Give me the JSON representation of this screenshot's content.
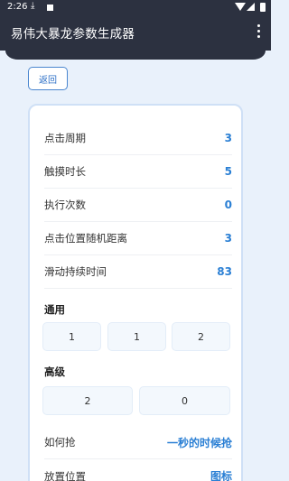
{
  "status_bar": {
    "time": "2:26",
    "download_icon": "download-icon",
    "wifi_icon": "wifi-icon",
    "signal_icon": "signal-icon",
    "battery_icon": "battery-icon"
  },
  "app_bar": {
    "title": "易伟大暴龙参数生成器",
    "menu_icon": "more-vert-icon"
  },
  "back_button": {
    "label": "返回"
  },
  "settings": [
    {
      "label": "点击周期",
      "value": "3"
    },
    {
      "label": "触摸时长",
      "value": "5"
    },
    {
      "label": "执行次数",
      "value": "0"
    },
    {
      "label": "点击位置随机距离",
      "value": "3"
    },
    {
      "label": "滑动持续时间",
      "value": "83"
    }
  ],
  "general": {
    "title": "通用",
    "values": [
      "1",
      "1",
      "2"
    ]
  },
  "advanced": {
    "title": "高级",
    "values": [
      "2",
      "0"
    ]
  },
  "how_to_grab": {
    "label": "如何抢",
    "value": "一秒的时候抢"
  },
  "placement": {
    "label": "放置位置",
    "value": "图标"
  },
  "colors": {
    "primary_dark": "#2c3140",
    "accent": "#2a7fd4",
    "background": "#e9f1fb"
  }
}
